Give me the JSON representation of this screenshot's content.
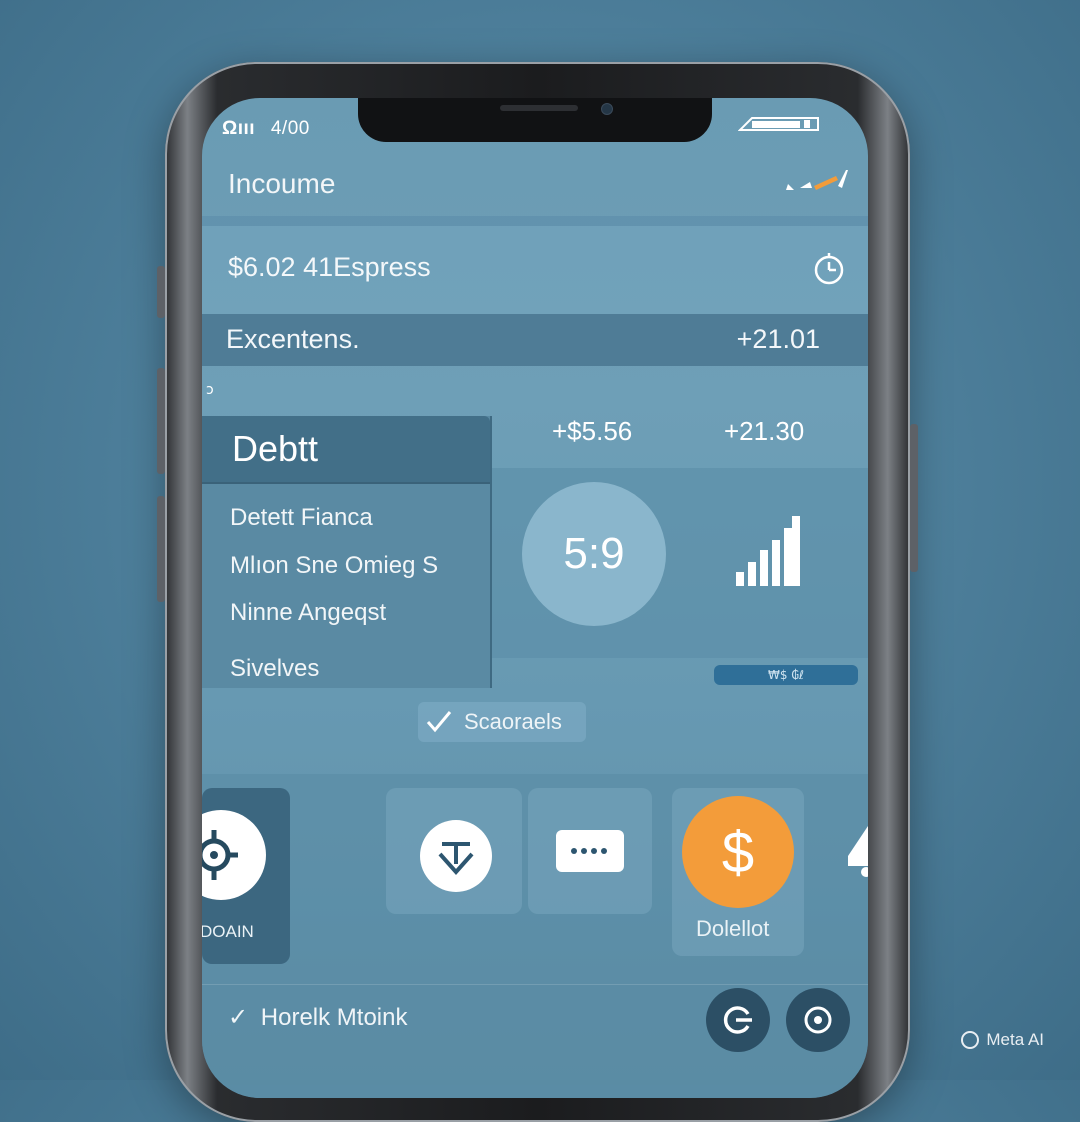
{
  "status_bar": {
    "carrier": "Ωııı",
    "time": "4/00",
    "battery_icon": "battery-icon"
  },
  "header": {
    "title": "Incoume",
    "edit_icon": "pen-icon"
  },
  "balance": {
    "text": "$6.02  41Espress",
    "action_icon": "clock-icon"
  },
  "expenses": {
    "label": "Excentens.",
    "value": "+21.01"
  },
  "debt_card": {
    "title": "Debtt",
    "items": [
      "Detett  Fianca",
      "Mlıon  Sne Omieg  S",
      "Ninne Angeqst",
      "Sivelves"
    ]
  },
  "stats": {
    "left": "+$5.56",
    "right": "+21.30"
  },
  "score": {
    "value": "5:9"
  },
  "chart_caption": "₩$ ₲ℓ",
  "search": {
    "label": "Scaoraels"
  },
  "tiles": [
    {
      "label": "DOAIN",
      "icon": "target-icon"
    },
    {
      "label": "",
      "icon": "download-icon"
    },
    {
      "label": "",
      "icon": "more-icon"
    },
    {
      "label": "Dolellot",
      "icon": "dollar-icon"
    }
  ],
  "footer": {
    "label": "Horelk Mtoink",
    "buttons": [
      "refresh-icon",
      "record-icon"
    ]
  },
  "watermark": "Meta AI",
  "colors": {
    "accent_orange": "#f39c3a",
    "screen_bg": "#6a9bb3",
    "dark_panel": "#426f88"
  }
}
